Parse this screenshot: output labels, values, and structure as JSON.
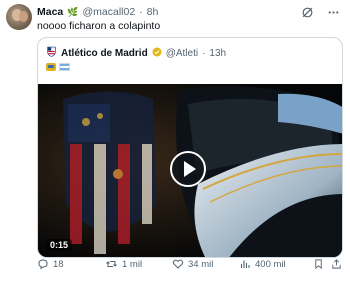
{
  "tweet": {
    "author_name": "Maca",
    "author_emoji": "🌿",
    "handle": "@macall02",
    "separator": "·",
    "time": "8h",
    "text": "noooo ficharon a colapinto"
  },
  "quote": {
    "author_name": "Atlético de Madrid",
    "handle": "@Atleti",
    "separator": "·",
    "time": "13h",
    "video_duration": "0:15"
  },
  "actions": {
    "replies": "18",
    "reposts": "1 mil",
    "likes": "34 mil",
    "views": "400 mil"
  },
  "colors": {
    "accent": "#1d9bf0",
    "muted": "#536471",
    "border": "#cfd9de",
    "verified_gold": "#e2b719"
  },
  "icons": [
    "grok-icon",
    "more-icon",
    "atletico-crest-icon",
    "verified-gold-icon",
    "race-car-icon",
    "argentina-flag-icon",
    "play-icon",
    "reply-icon",
    "repost-icon",
    "like-icon",
    "views-icon",
    "bookmark-icon",
    "share-icon"
  ]
}
